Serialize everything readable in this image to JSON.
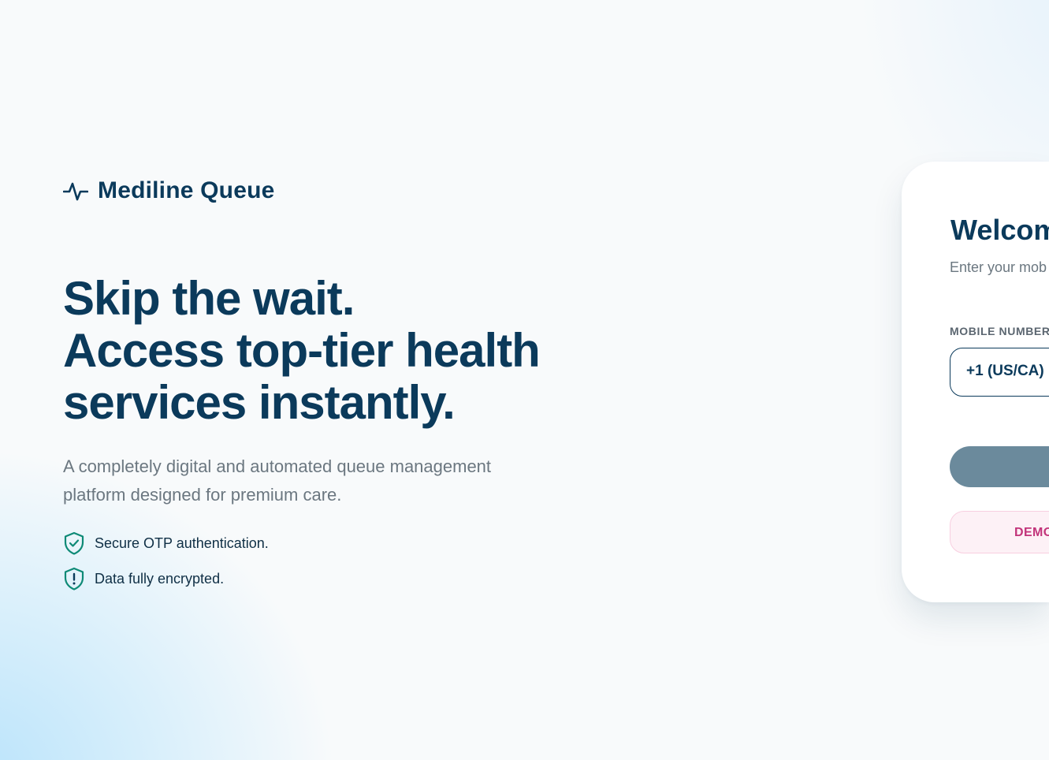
{
  "brand": {
    "name": "Mediline Queue",
    "icon": "pulse-icon",
    "color": "#0b3a5b"
  },
  "hero": {
    "headline": [
      "Skip the wait.",
      "Access top-tier health",
      "services instantly."
    ],
    "subtitle": "A completely digital and automated queue management platform designed for premium care."
  },
  "features": [
    {
      "icon": "shield-check-icon",
      "text": "Secure OTP authentication."
    },
    {
      "icon": "shield-alert-icon",
      "text": "Data fully encrypted."
    }
  ],
  "login": {
    "title": "Welcom",
    "description": "Enter your mob account.",
    "mobile_label": "MOBILE NUMBER",
    "country_code": "+1 (US/CA)",
    "demo_label": "DEMO",
    "submit_color": "#6b8a9c",
    "demo_color": "#c2347a"
  }
}
